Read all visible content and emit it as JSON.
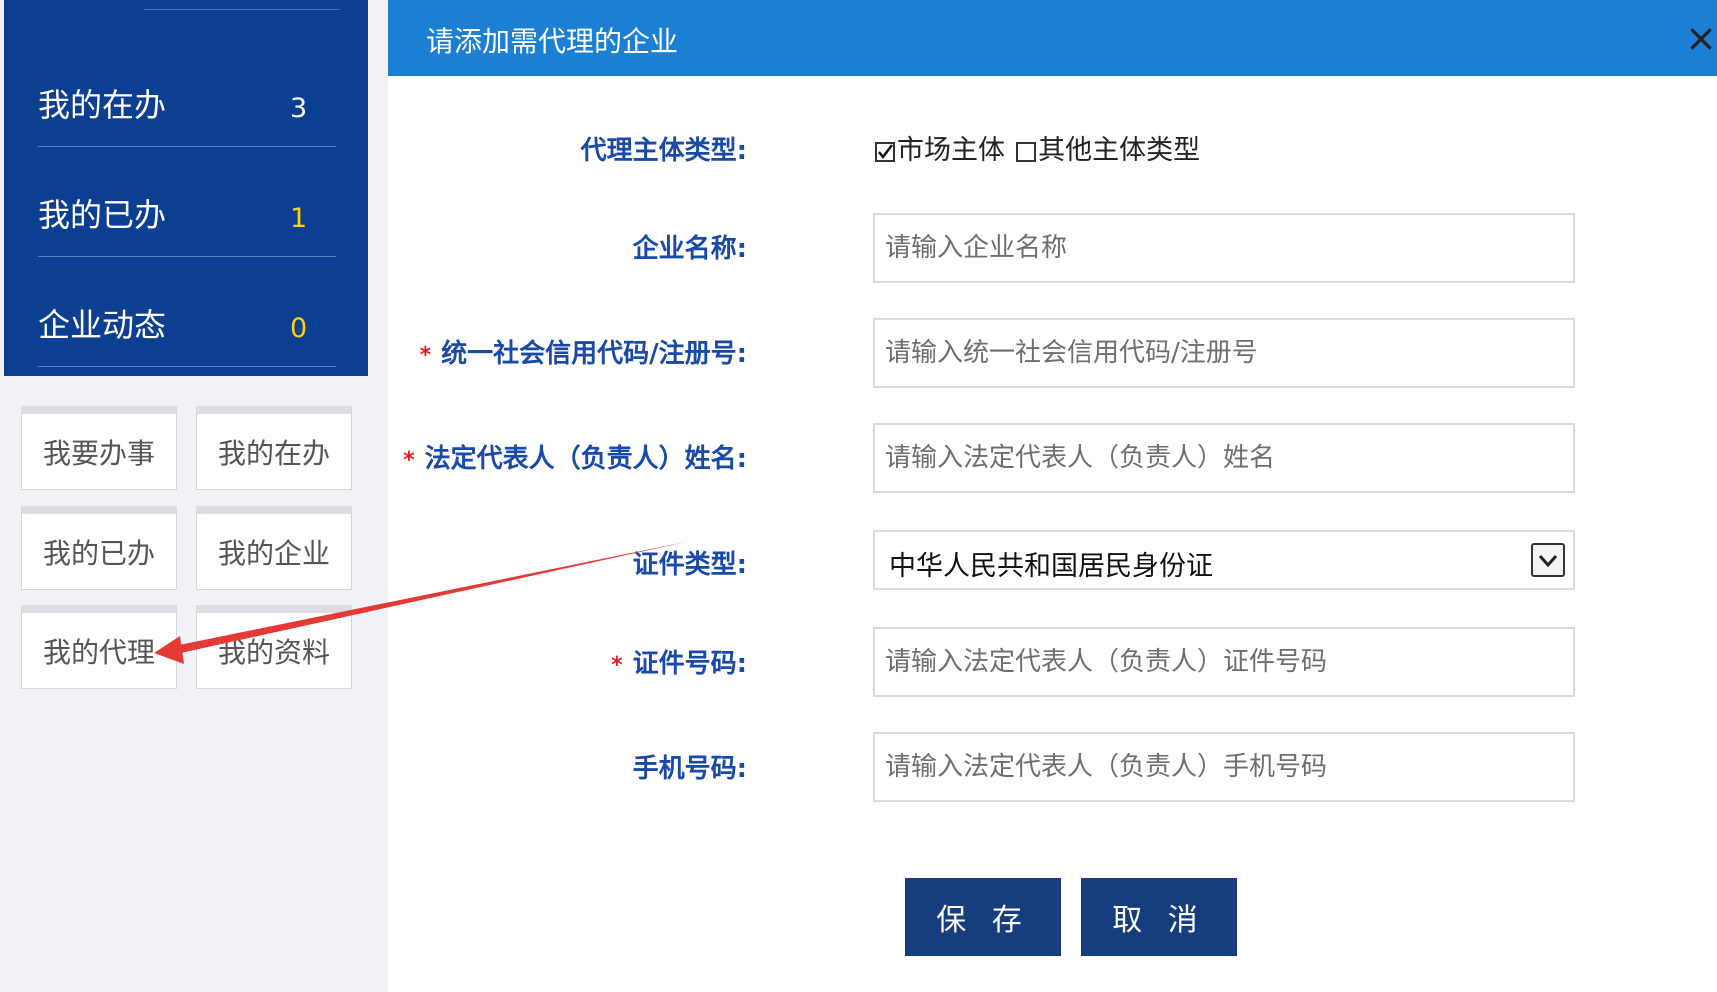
{
  "stats": [
    {
      "label": "我的在办",
      "count": "3",
      "count_color": "#ffffff"
    },
    {
      "label": "我的已办",
      "count": "1",
      "count_color": "#ffd200"
    },
    {
      "label": "企业动态",
      "count": "0",
      "count_color": "#ffd200"
    }
  ],
  "tiles": [
    "我要办事",
    "我的在办",
    "我的已办",
    "我的企业",
    "我的代理",
    "我的资料"
  ],
  "dialog": {
    "title": "请添加需代理的企业",
    "close_icon": "×"
  },
  "form": {
    "agent_type": {
      "label": "代理主体类型:",
      "options": [
        {
          "label": "市场主体",
          "checked": true
        },
        {
          "label": "其他主体类型",
          "checked": false
        }
      ]
    },
    "company_name": {
      "label": "企业名称:",
      "placeholder": "请输入企业名称",
      "required": false
    },
    "credit_code": {
      "label": "统一社会信用代码/注册号:",
      "placeholder": "请输入统一社会信用代码/注册号",
      "required": true
    },
    "legal_rep_name": {
      "label": "法定代表人（负责人）姓名:",
      "placeholder": "请输入法定代表人（负责人）姓名",
      "required": true
    },
    "id_type": {
      "label": "证件类型:",
      "value": "中华人民共和国居民身份证",
      "required": false
    },
    "id_number": {
      "label": "证件号码:",
      "placeholder": "请输入法定代表人（负责人）证件号码",
      "required": true
    },
    "phone": {
      "label": "手机号码:",
      "placeholder": "请输入法定代表人（负责人）手机号码",
      "required": false
    },
    "required_mark": "*"
  },
  "buttons": {
    "save": "保 存",
    "cancel": "取 消"
  },
  "colors": {
    "sidebar_blue": "#0c3e91",
    "header_blue": "#1b7fd3",
    "label_blue": "#1a4aa8",
    "button_navy": "#163e7f",
    "annotation_red": "#e53935"
  }
}
